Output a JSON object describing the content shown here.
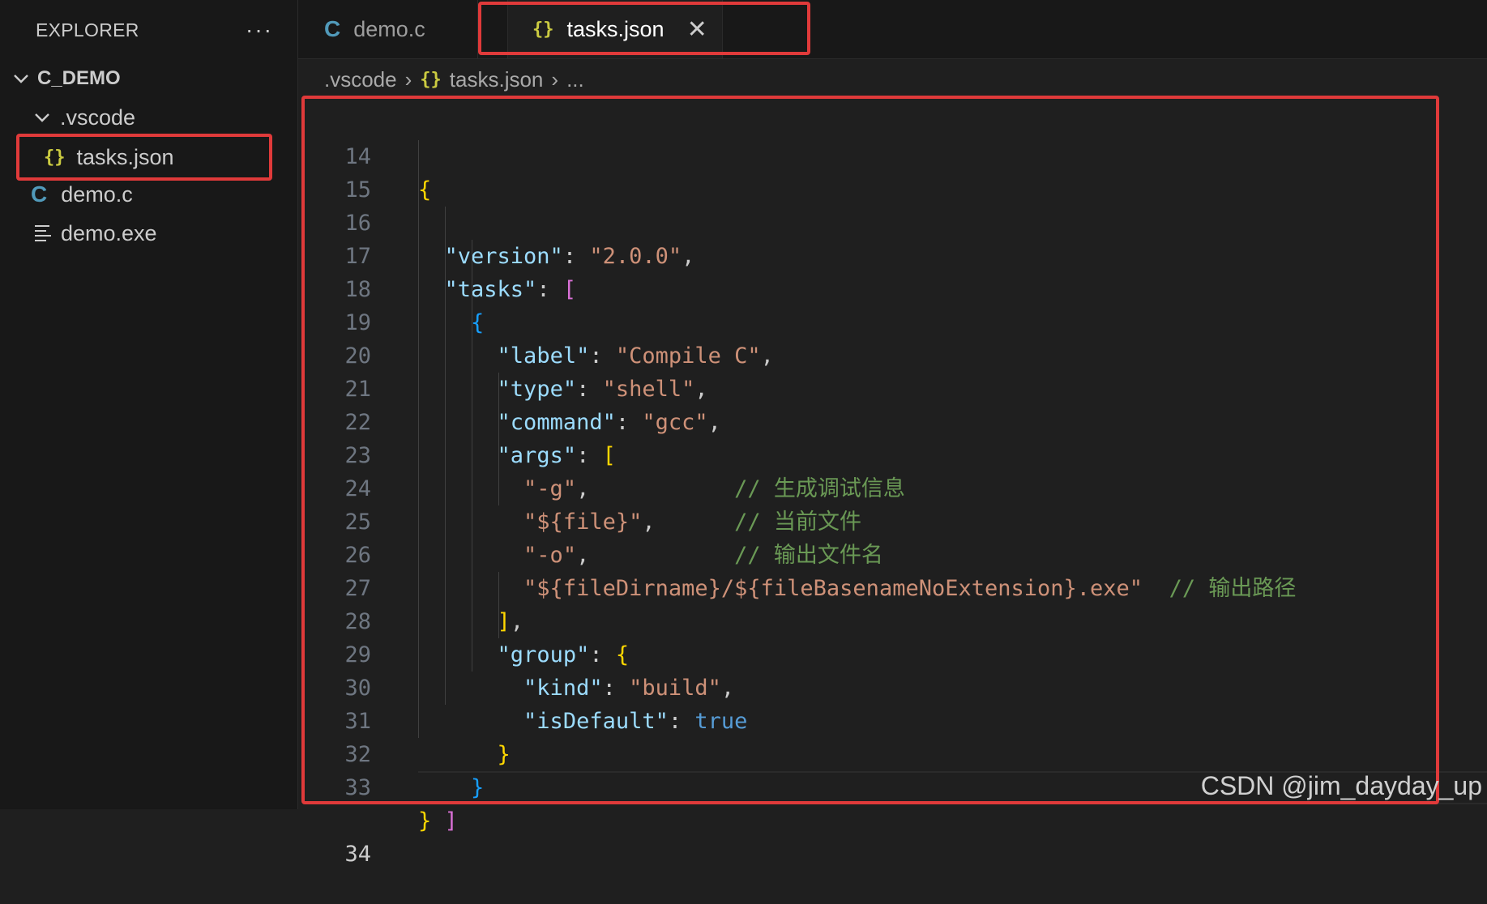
{
  "sidebar": {
    "title": "EXPLORER",
    "more_label": "···",
    "root_label": "C_DEMO",
    "folder_label": ".vscode",
    "files": [
      {
        "label": "tasks.json"
      },
      {
        "label": "demo.c"
      },
      {
        "label": "demo.exe"
      }
    ]
  },
  "tabs": [
    {
      "label": "demo.c",
      "active": false
    },
    {
      "label": "tasks.json",
      "active": true
    }
  ],
  "breadcrumb": {
    "folder": ".vscode",
    "file": "tasks.json",
    "more": "..."
  },
  "editor": {
    "line_numbers": [
      "14",
      "15",
      "16",
      "17",
      "18",
      "19",
      "20",
      "21",
      "22",
      "23",
      "24",
      "25",
      "26",
      "27",
      "28",
      "29",
      "30",
      "31",
      "32",
      "33",
      "34"
    ],
    "code": {
      "version_key": "\"version\"",
      "version_val": "\"2.0.0\"",
      "tasks_key": "\"tasks\"",
      "label_key": "\"label\"",
      "label_val": "\"Compile C\"",
      "type_key": "\"type\"",
      "type_val": "\"shell\"",
      "command_key": "\"command\"",
      "command_val": "\"gcc\"",
      "args_key": "\"args\"",
      "arg1": "\"-g\"",
      "arg2": "\"${file}\"",
      "arg3": "\"-o\"",
      "arg4": "\"${fileDirname}/${fileBasenameNoExtension}.exe\"",
      "comment1": "// 生成调试信息",
      "comment2": "// 当前文件",
      "comment3": "// 输出文件名",
      "comment4": "// 输出路径",
      "group_key": "\"group\"",
      "kind_key": "\"kind\"",
      "kind_val": "\"build\"",
      "isdefault_key": "\"isDefault\"",
      "isdefault_val": "true"
    }
  },
  "watermark": "CSDN @jim_dayday_up",
  "colors": {
    "highlight_box": "#e03a3a",
    "json_icon": "#cbcb41",
    "c_icon": "#519aba"
  }
}
